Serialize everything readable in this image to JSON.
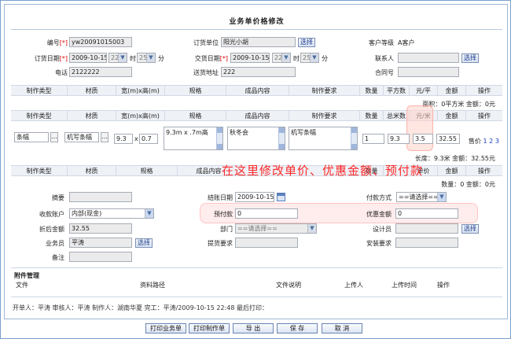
{
  "title": "业务单价格修改",
  "header": {
    "order_no_label": "编号",
    "req_mark": "[*]",
    "order_no": "yw20091015003",
    "order_unit_label": "订货单位",
    "order_unit": "阳光小胡",
    "select_btn": "选择",
    "customer_level_label": "客户等级",
    "customer_level": "A客户",
    "order_date_label": "订货日期",
    "order_date": "2009-10-15",
    "order_hour": "22",
    "order_min": "25",
    "hour_unit": "时",
    "min_unit": "分",
    "delivery_date_label": "交货日期",
    "delivery_date": "2009-10-15",
    "delivery_hour": "22",
    "delivery_min": "25",
    "contact_label": "联系人",
    "phone_label": "电话",
    "phone": "2122222",
    "address_label": "送货地址",
    "address": "222",
    "contract_label": "合同号"
  },
  "table1": {
    "columns": [
      "制作类型",
      "材质",
      "宽(m)x高(m)",
      "规格",
      "成品内容",
      "制作要求",
      "数量",
      "平方数",
      "元/平",
      "金额",
      "操作"
    ],
    "summary": "面积：0平方米  金额：0元"
  },
  "table2": {
    "columns": [
      "制作类型",
      "材质",
      "宽(m)x高(m)",
      "规格",
      "成品内容",
      "制作要求",
      "数量",
      "总米数",
      "元/米",
      "金额",
      "操作"
    ],
    "row": {
      "type": "条幅",
      "material": "机写条幅",
      "width": "9.3",
      "x": "x",
      "height": "0.7",
      "spec": "9.3m x .7m高",
      "content": "秋冬会",
      "requirement": "机写条幅",
      "qty": "1",
      "meters": "9.3",
      "price": "3.5",
      "amount": "32.55",
      "op_label": "售价",
      "op_links": "1 2 3"
    },
    "summary": "长度：9.3米  金额：32.55元"
  },
  "table3": {
    "columns": [
      "制作类型",
      "材质",
      "规格",
      "成品内容",
      "制作要求",
      "数量",
      "单价",
      "金额",
      "操作"
    ],
    "summary": "数量：0  金额：0元"
  },
  "annotation": "在这里修改单价、优惠金额、预付款",
  "bottom": {
    "summary_label": "摘要",
    "finish_date_label": "结账日期",
    "finish_date": "2009-10-15",
    "pay_method_label": "付款方式",
    "pay_method": "==请选择==",
    "account_label": "收款账户",
    "account": "内部(现金)",
    "prepay_label": "预付款",
    "prepay": "0",
    "discount_label": "优惠金额",
    "discount": "0",
    "after_discount_label": "折后金额",
    "after_discount": "32.55",
    "dept_label": "部门",
    "dept": "==请选择==",
    "designer_label": "设计员",
    "salesman_label": "业务员",
    "salesman": "平涛",
    "proof_req_label": "提货要求",
    "installer_label": "安装要求",
    "remark_label": "备注"
  },
  "attachments": {
    "title": "附件管理",
    "columns": [
      "文件",
      "资料路径",
      "文件说明",
      "上传人",
      "上传时间",
      "操作"
    ]
  },
  "footer_info": "开单人：平涛    审核人：平涛    制作人：湖南华夏    完工：平涛/2009-10-15 22:48    最后打印：",
  "buttons": {
    "print_order": "打印业务单",
    "print_make": "打印制作单",
    "export": "导 出",
    "save": "保 存",
    "cancel": "取 消"
  }
}
